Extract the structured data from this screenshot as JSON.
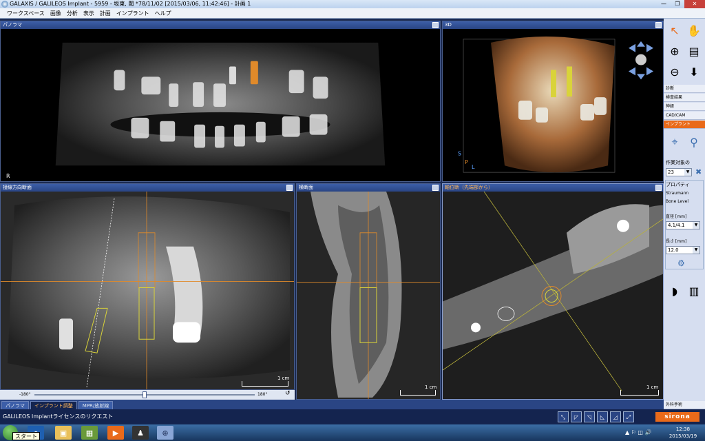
{
  "window": {
    "title": "GALAXIS / GALILEOS Implant - 5959 - 坂東, 閾 *78/11/02 [2015/03/06, 11:42:46] - 計画 1",
    "controls": [
      "—",
      "❐",
      "✕"
    ]
  },
  "menu": [
    "ワークスペース",
    "画像",
    "分析",
    "表示",
    "計画",
    "インプラント",
    "ヘルプ"
  ],
  "panels": {
    "panorama": {
      "title": "パノラマ",
      "side_marker": "R"
    },
    "view3d": {
      "title": "3D",
      "axis_s": "S",
      "axis_p": "P",
      "axis_l": "L"
    },
    "tangential": {
      "title": "接線方向断面",
      "scale": "1 cm"
    },
    "cross": {
      "title": "横断面",
      "scale": "1 cm"
    },
    "axial": {
      "title": "軸位断（先端部から）",
      "scale": "1 cm"
    }
  },
  "slider": {
    "min_label": "-180°",
    "max_label": "180°",
    "value_percent": 50
  },
  "bottom_tabs": [
    {
      "label": "パノラマ",
      "active": false
    },
    {
      "label": "インプラント調整",
      "active": true
    },
    {
      "label": "MPR/放射線",
      "active": false
    }
  ],
  "status": {
    "text": "GALILEOS Implantライセンスのリクエスト",
    "brand": "sirona",
    "icons": [
      "⤡",
      "◸",
      "◹",
      "◺",
      "◿",
      "⤢"
    ]
  },
  "sidebar": {
    "tabs": [
      {
        "label": "診断",
        "active": false
      },
      {
        "label": "検査結果",
        "active": false
      },
      {
        "label": "神経",
        "active": false
      },
      {
        "label": "CAD/CAM",
        "active": false
      },
      {
        "label": "インプラント",
        "active": true
      }
    ],
    "target_label": "作業対象の",
    "target_value": "23",
    "properties_label": "プロパティ",
    "manufacturer": "Straumann",
    "product_line": "Bone Level",
    "diameter_label": "直径 [mm]",
    "diameter_value": "4.1/4.1",
    "length_label": "長さ [mm]",
    "length_value": "12.0",
    "bottom_label": "外科手術"
  },
  "taskbar": {
    "start_tooltip": "スタート",
    "time": "12:38",
    "date": "2015/03/19",
    "tray_text": "▲ ⚐ ◫ 🔊"
  },
  "colors": {
    "accent": "#e96a1a",
    "panel_header": "#2a4584",
    "implant": "#d9d33a",
    "guide": "#e08a2a"
  }
}
